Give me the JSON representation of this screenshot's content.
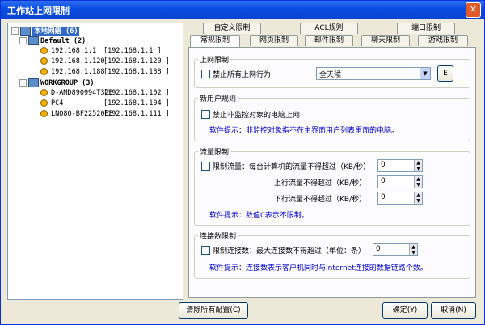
{
  "window": {
    "title": "工作站上网限制",
    "close_label": "✕"
  },
  "tree": {
    "root_label": "本地网络 (6)",
    "groups": [
      {
        "label": "Default (2)",
        "items": [
          {
            "name": "192.168.1.1",
            "ip": "[192.168.1.1    ]"
          },
          {
            "name": "192.168.1.120",
            "ip": "[192.168.1.120  ]"
          },
          {
            "name": "192.168.1.188",
            "ip": "[192.168.1.188  ]"
          }
        ]
      },
      {
        "label": "WORKGROUP (3)",
        "items": [
          {
            "name": "D-AMD890994T320",
            "ip": "[192.168.1.102  ]"
          },
          {
            "name": "PC4",
            "ip": "[192.168.1.104  ]"
          },
          {
            "name": "LNO8O-BF22520EE",
            "ip": "[192.168.1.111  ]"
          }
        ]
      }
    ]
  },
  "tabs": {
    "row1": [
      "自定义限制",
      "ACL规则",
      "端口限制"
    ],
    "row2": [
      "常规限制",
      "网页限制",
      "邮件限制",
      "聊天限制",
      "游戏限制"
    ]
  },
  "internet": {
    "title": "上网限制",
    "block_all_label": "禁止所有上网行为",
    "schedule_value": "全天候",
    "edit_button": "E"
  },
  "new_user": {
    "title": "新用户规则",
    "label": "禁止非监控对象的电脑上网",
    "hint": "软件提示：非监控对象指不在主界面用户列表里面的电脑。"
  },
  "traffic": {
    "title": "流量限制",
    "limit_label": "限制流量：每台计算机的流量不得超过（KB/秒）",
    "upload_label": "上行流量不得超过（KB/秒）",
    "download_label": "下行流量不得超过（KB/秒）",
    "values": [
      "0",
      "0",
      "0"
    ],
    "hint": "软件提示：数值0表示不限制。"
  },
  "connection": {
    "title": "连接数限制",
    "label": "限制连接数：最大连接数不得超过（单位：条）",
    "value": "0",
    "hint": "软件提示：连接数表示客户机同时与Internet连接的数据链路个数。"
  },
  "buttons": {
    "clear_all": "清除所有配置(C)",
    "ok": "确定(Y)",
    "cancel": "取消(N)"
  }
}
